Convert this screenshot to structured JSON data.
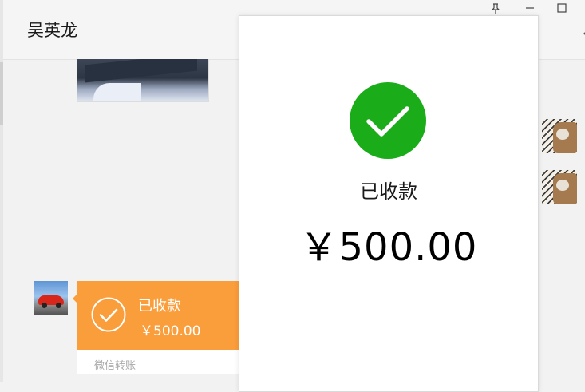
{
  "chat": {
    "contact_name": "吴英龙"
  },
  "window_controls": {
    "pin": "pin-icon",
    "minimize": "minimize-icon",
    "maximize": "maximize-icon"
  },
  "transfer_card": {
    "status": "已收款",
    "amount": "￥500.00",
    "footer": "微信转账",
    "color": "#fa9d3b"
  },
  "receipt_popup": {
    "status": "已收款",
    "amount": "￥500.00",
    "icon": "check-circle-icon",
    "icon_color": "#1aad19"
  }
}
